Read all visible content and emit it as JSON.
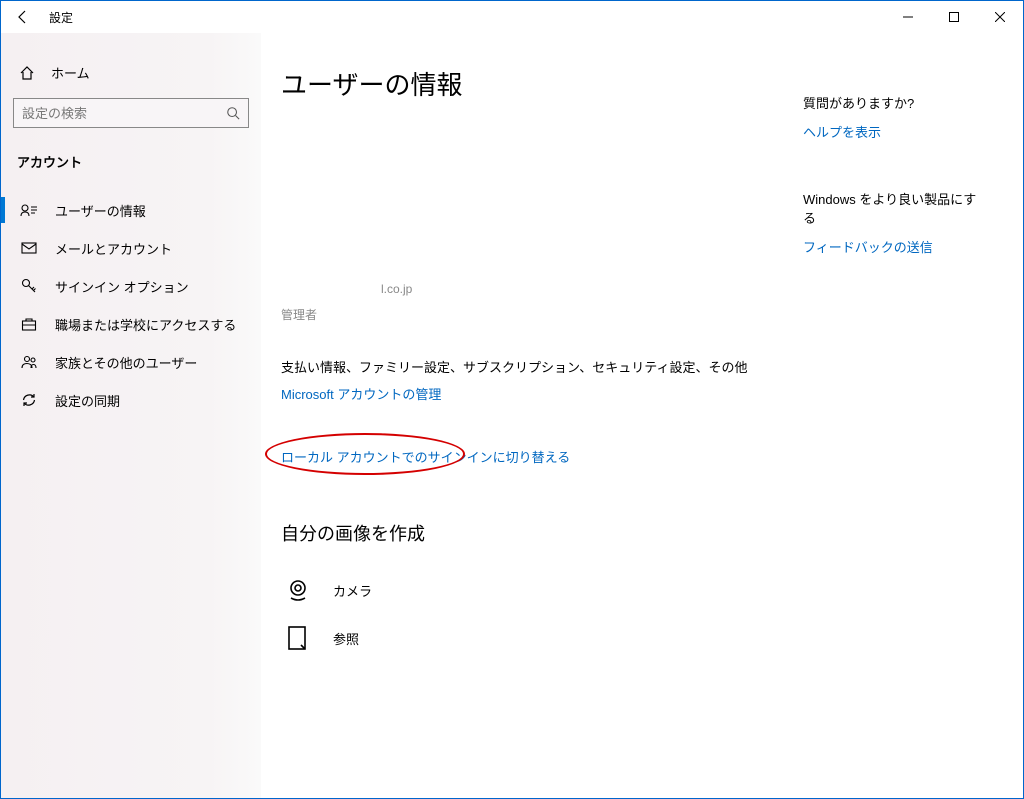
{
  "window": {
    "title": "設定"
  },
  "sidebar": {
    "home": "ホーム",
    "search_placeholder": "設定の検索",
    "section": "アカウント",
    "items": [
      {
        "label": "ユーザーの情報"
      },
      {
        "label": "メールとアカウント"
      },
      {
        "label": "サインイン オプション"
      },
      {
        "label": "職場または学校にアクセスする"
      },
      {
        "label": "家族とその他のユーザー"
      },
      {
        "label": "設定の同期"
      }
    ]
  },
  "main": {
    "heading": "ユーザーの情報",
    "email_suffix": "l.co.jp",
    "role": "管理者",
    "payment_line": "支払い情報、ファミリー設定、サブスクリプション、セキュリティ設定、その他",
    "ms_account_link": "Microsoft アカウントの管理",
    "local_account_link": "ローカル アカウントでのサインインに切り替える",
    "create_image_heading": "自分の画像を作成",
    "camera_label": "カメラ",
    "browse_label": "参照"
  },
  "rail": {
    "question": "質問がありますか?",
    "help_link": "ヘルプを表示",
    "improve": "Windows をより良い製品にする",
    "feedback_link": "フィードバックの送信"
  }
}
